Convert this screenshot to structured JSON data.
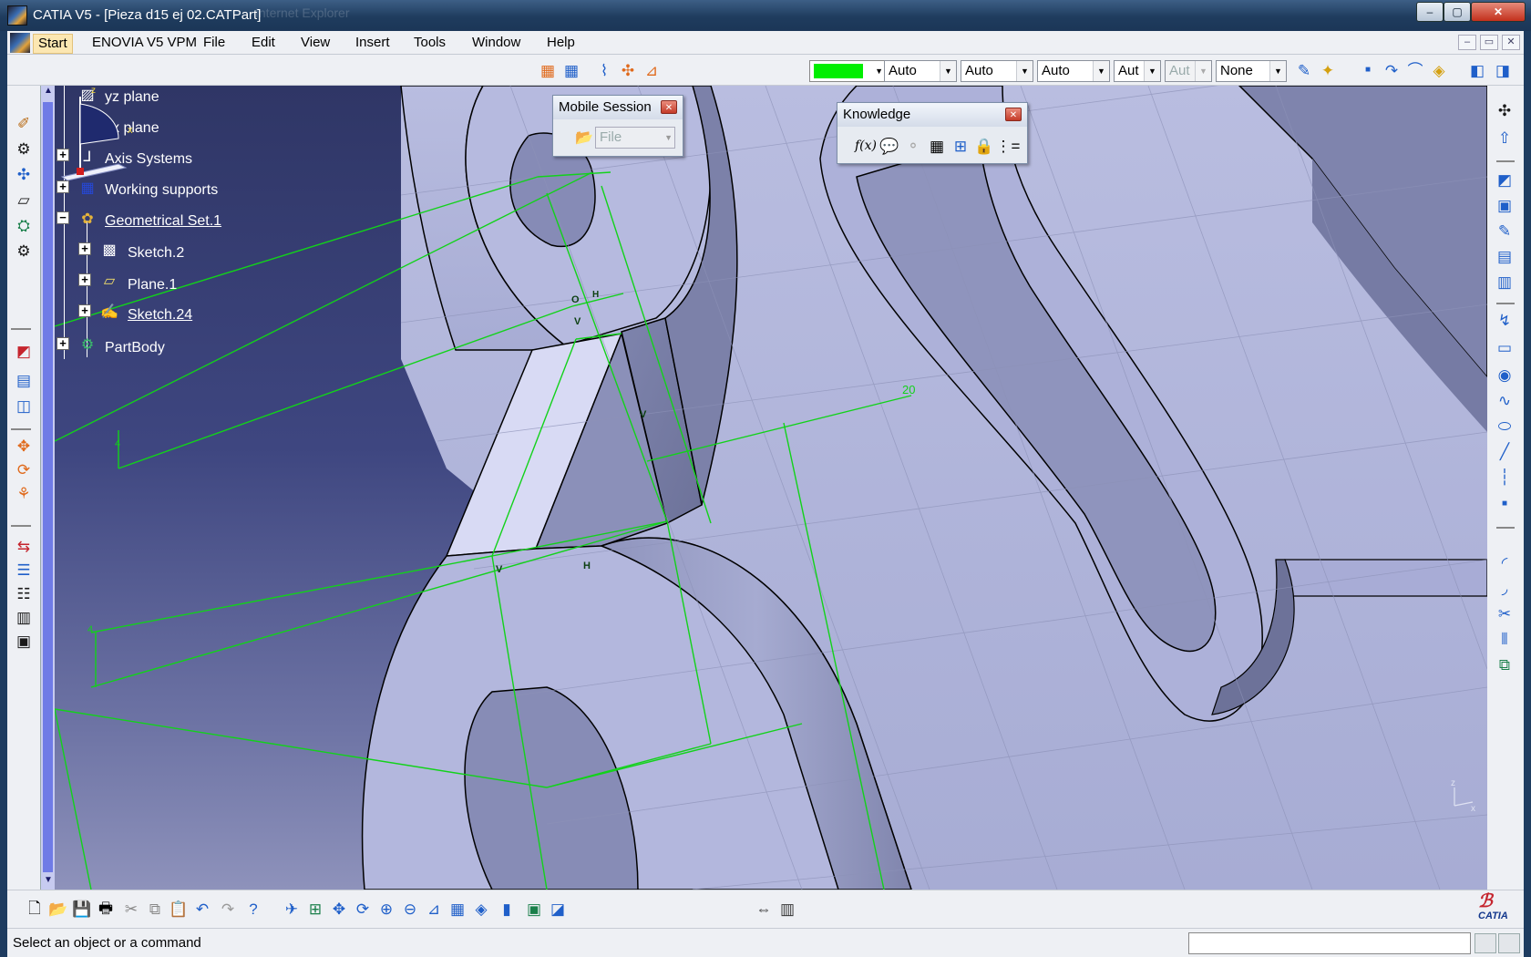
{
  "window": {
    "title": "CATIA V5 - [Pieza d15 ej 02.CATPart]",
    "ghost_title": "Internet Explorer",
    "controls": [
      "–",
      "▢",
      "✕"
    ]
  },
  "menubar": {
    "items": [
      "Start",
      "ENOVIA V5 VPM",
      "File",
      "Edit",
      "View",
      "Insert",
      "Tools",
      "Window",
      "Help"
    ],
    "mdi_controls": [
      "–",
      "▭",
      "✕"
    ]
  },
  "properties_toolbar": {
    "color": "#00ee00",
    "transparency": "Auto",
    "linetype": "Auto",
    "thickness": "Auto",
    "point_symbol": "Aut",
    "disabled_combo": "Aut",
    "layer": "None"
  },
  "tree": {
    "items": [
      {
        "label": "yz plane",
        "icon": "plane-icon"
      },
      {
        "label": "zx plane",
        "icon": "plane-icon"
      },
      {
        "label": "Axis Systems",
        "icon": "axis-system-icon"
      },
      {
        "label": "Working supports",
        "icon": "working-support-icon"
      },
      {
        "label": "Geometrical Set.1",
        "icon": "geometrical-set-icon"
      },
      {
        "label": "Sketch.2",
        "icon": "sketch-icon"
      },
      {
        "label": "Plane.1",
        "icon": "plane-icon"
      },
      {
        "label": "Sketch.24",
        "icon": "sketch-icon"
      },
      {
        "label": "PartBody",
        "icon": "part-body-icon"
      }
    ]
  },
  "mobile_session": {
    "title": "Mobile Session",
    "combo_value": "File"
  },
  "knowledge": {
    "title": "Knowledge"
  },
  "sketch_annotations": {
    "dimension": "20",
    "constraint_h": "H",
    "constraint_v": "V",
    "small_dim": "4",
    "coincidence": "O"
  },
  "compass": {
    "x_label": "x",
    "z_label": "z"
  },
  "axis_triad": {
    "z_label": "z",
    "x_label": "x"
  },
  "status": {
    "message": "Select an object or a command"
  },
  "logo": {
    "text": "CATIA"
  }
}
